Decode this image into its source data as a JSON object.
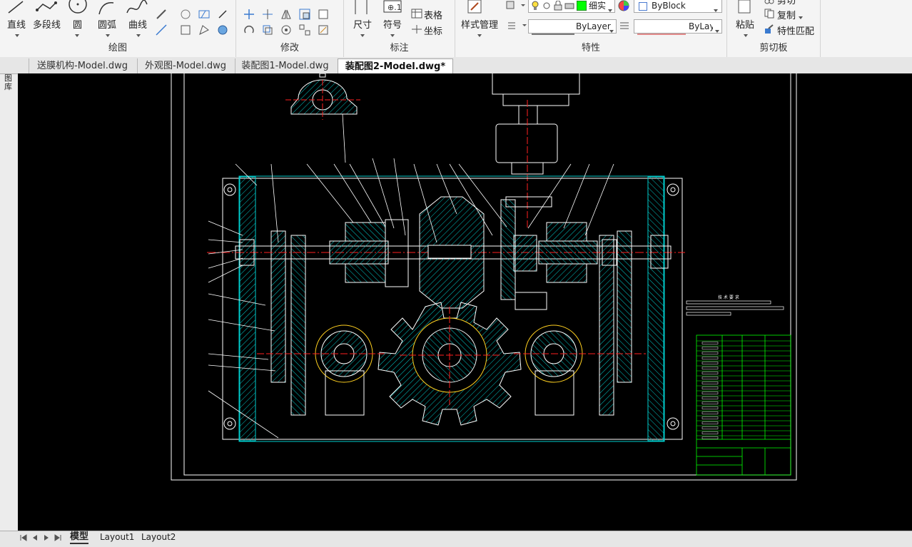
{
  "ribbon": {
    "draw": {
      "label": "绘图",
      "line": "直线",
      "polyline": "多段线",
      "circle": "圆",
      "arc": "圆弧",
      "curve": "曲线"
    },
    "modify": {
      "label": "修改"
    },
    "annotate": {
      "label": "标注",
      "dimension": "尺寸",
      "symbol": "符号",
      "table": "表格",
      "coordinate": "坐标"
    },
    "properties": {
      "label": "特性",
      "style_manager": "样式管理",
      "lineweight": "细实",
      "color": "ByBlock",
      "linetype": "ByLayer",
      "linetype2": "ByLayer"
    },
    "clipboard": {
      "label": "剪切板",
      "paste": "粘贴",
      "cut": "剪切",
      "copy": "复制",
      "match": "特性匹配"
    }
  },
  "side_panel": {
    "label": "图库"
  },
  "tabs": [
    {
      "label": "送膜机构-Model.dwg",
      "active": false
    },
    {
      "label": "外观图-Model.dwg",
      "active": false
    },
    {
      "label": "装配图1-Model.dwg",
      "active": false
    },
    {
      "label": "装配图2-Model.dwg*",
      "active": true
    }
  ],
  "close_glyph": "×",
  "layout_tabs": [
    {
      "label": "模型",
      "active": true
    },
    {
      "label": "Layout1",
      "active": false
    },
    {
      "label": "Layout2",
      "active": false
    }
  ],
  "drawing": {
    "tech_requirements_title": "技 术 要 求"
  },
  "colors": {
    "canvas_bg": "#000000",
    "hatch": "#00cccc",
    "centerline": "#ff2020",
    "outline": "#ffffff",
    "green": "#00ff00",
    "ribbon_bg": "#f4f4f4"
  }
}
